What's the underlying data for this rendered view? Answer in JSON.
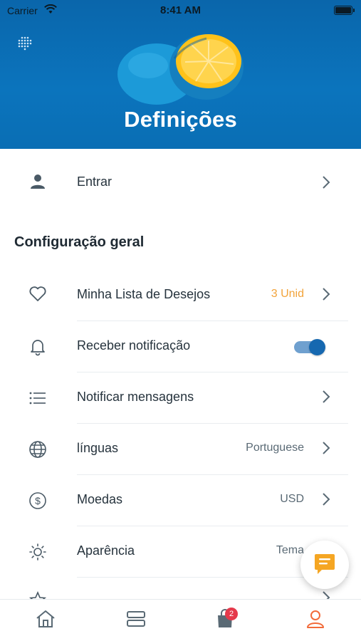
{
  "status_bar": {
    "carrier": "Carrier",
    "time": "8:41 AM"
  },
  "header": {
    "title": "Definições"
  },
  "login": {
    "label": "Entrar"
  },
  "section": {
    "title": "Configuração geral"
  },
  "items": [
    {
      "label": "Minha Lista de Desejos",
      "value": "3 Unid",
      "icon": "heart-icon"
    },
    {
      "label": "Receber notificação",
      "toggle_on": true,
      "icon": "bell-icon"
    },
    {
      "label": "Notificar mensagens",
      "icon": "list-icon"
    },
    {
      "label": "línguas",
      "value": "Portuguese",
      "icon": "globe-icon"
    },
    {
      "label": "Moedas",
      "value": "USD",
      "icon": "dollar-icon"
    },
    {
      "label": "Aparência",
      "value": "Tema",
      "icon": "sun-icon"
    }
  ],
  "tab_bar": {
    "tabs": [
      "home-icon",
      "categories-icon",
      "cart-icon",
      "profile-icon"
    ],
    "cart_badge": "2",
    "active_color": "#f26b3a"
  },
  "colors": {
    "accent": "#0b6fb6",
    "value_orange": "#f2a33a",
    "chat_orange": "#f5a623"
  }
}
